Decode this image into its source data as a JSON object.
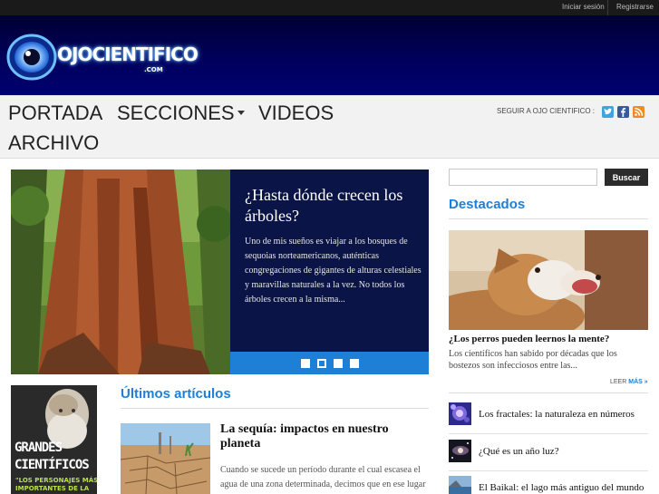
{
  "topbar": {
    "login": "Iniciar sesión",
    "register": "Registrarse"
  },
  "logo": {
    "ojo": "OJO",
    "cientifico": "CIENTIFICO",
    "com": ".COM"
  },
  "nav": {
    "items": [
      {
        "label": "PORTADA"
      },
      {
        "label": "SECCIONES"
      },
      {
        "label": "VIDEOS"
      },
      {
        "label": "ARCHIVO"
      }
    ],
    "follow_label": "SEGUIR A OJO CIENTIFICO :",
    "social": [
      "twitter-icon",
      "facebook-icon",
      "rss-icon"
    ]
  },
  "slider": {
    "title": "¿Hasta dónde crecen los árboles?",
    "excerpt": "Uno de mis sueños es viajar a los bosques de sequoias norteamericanos, auténticas congregaciones de gigantes de alturas celestiales y maravillas naturales a la vez. No todos los árboles crecen a la misma...",
    "dots": 4,
    "active_dot": 2
  },
  "sidebar": {
    "search_placeholder": "",
    "search_button": "Buscar",
    "heading": "Destacados",
    "featured": {
      "title": "¿Los perros pueden leernos la mente?",
      "excerpt": "Los científicos han sabido por décadas que los bostezos son infecciosos entre las...",
      "read_more_prefix": "LEER",
      "read_more_suffix": "MÁS »"
    },
    "list": [
      {
        "title": "Los fractales: la naturaleza en números"
      },
      {
        "title": "¿Qué es un año luz?"
      },
      {
        "title": "El Baikal: el lago más antiguo del mundo"
      }
    ]
  },
  "ad": {
    "title": "GRANDES CIENTÍFICOS",
    "subtitle": "\"LOS PERSONAJES MÁS IMPORTANTES DE LA"
  },
  "latest": {
    "heading": "Últimos artículos",
    "article": {
      "title": "La sequía: impactos en nuestro planeta",
      "excerpt": "Cuando se sucede un período durante el cual escasea el agua de una zona determinada, decimos que en ese lugar hay una sequía..."
    }
  },
  "colors": {
    "accent": "#1e7fd6",
    "header": "#00005c",
    "slide_panel": "#0a1446"
  }
}
